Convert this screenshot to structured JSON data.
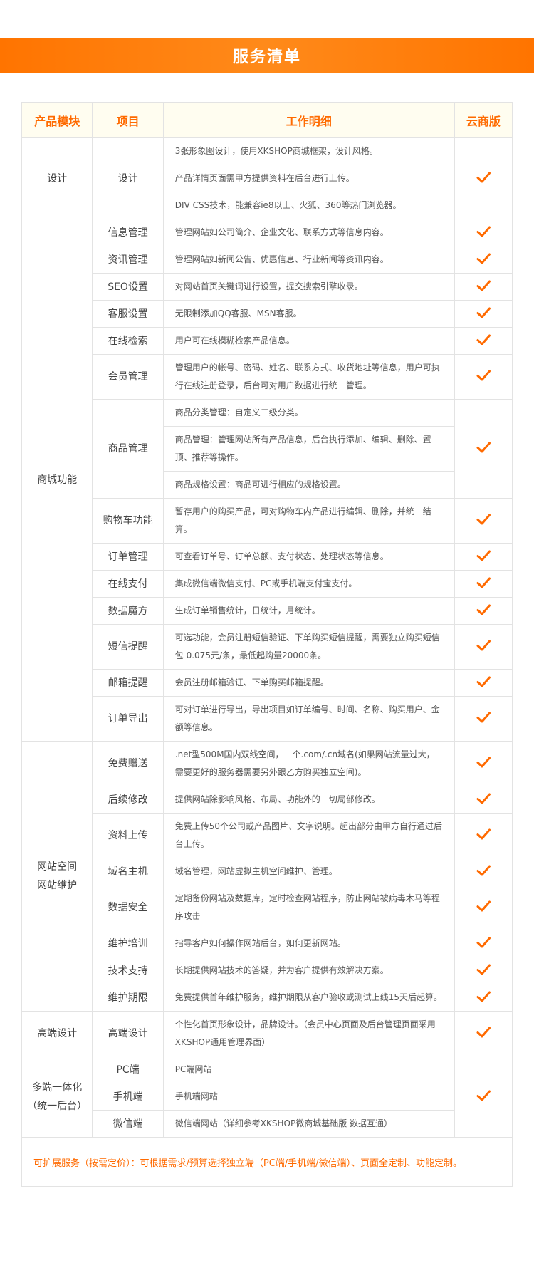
{
  "header": {
    "title": "服务清单"
  },
  "columns": [
    "产品模块",
    "项目",
    "工作明细",
    "云商版"
  ],
  "groups": [
    {
      "module": "设计",
      "rows": [
        {
          "item": "设计",
          "details": [
            "3张形象图设计，使用XKSHOP商城框架，设计风格。",
            "产品详情页面需甲方提供资料在后台进行上传。",
            "DIV CSS技术，能兼容ie8以上、火狐、360等热门浏览器。"
          ]
        }
      ]
    },
    {
      "module": "商城功能",
      "rows": [
        {
          "item": "信息管理",
          "details": [
            "管理网站如公司简介、企业文化、联系方式等信息内容。"
          ]
        },
        {
          "item": "资讯管理",
          "details": [
            "管理网站如新闻公告、优惠信息、行业新闻等资讯内容。"
          ]
        },
        {
          "item": "SEO设置",
          "details": [
            "对网站首页关键词进行设置，提交搜索引擎收录。"
          ]
        },
        {
          "item": "客服设置",
          "details": [
            "无限制添加QQ客服、MSN客服。"
          ]
        },
        {
          "item": "在线检索",
          "details": [
            "用户可在线模糊检索产品信息。"
          ]
        },
        {
          "item": "会员管理",
          "details": [
            "管理用户的帐号、密码、姓名、联系方式、收货地址等信息，用户可执行在线注册登录，后台可对用户数据进行统一管理。"
          ]
        },
        {
          "item": "商品管理",
          "details": [
            "商品分类管理：自定义二级分类。",
            "商品管理：管理网站所有产品信息，后台执行添加、编辑、删除、置顶、推荐等操作。",
            "商品规格设置：商品可进行相应的规格设置。"
          ]
        },
        {
          "item": "购物车功能",
          "details": [
            "暂存用户的购买产品，可对购物车内产品进行编辑、删除，并统一结算。"
          ]
        },
        {
          "item": "订单管理",
          "details": [
            "可查看订单号、订单总额、支付状态、处理状态等信息。"
          ]
        },
        {
          "item": "在线支付",
          "details": [
            "集成微信端微信支付、PC或手机端支付宝支付。"
          ]
        },
        {
          "item": "数据魔方",
          "details": [
            "生成订单销售统计，日统计，月统计。"
          ]
        },
        {
          "item": "短信提醒",
          "details": [
            "可选功能，会员注册短信验证、下单购买短信提醒，需要独立购买短信包 0.075元/条，最低起购量20000条。"
          ]
        },
        {
          "item": "邮箱提醒",
          "details": [
            "会员注册邮箱验证、下单购买邮箱提醒。"
          ]
        },
        {
          "item": "订单导出",
          "details": [
            "可对订单进行导出，导出项目如订单编号、时间、名称、购买用户、金额等信息。"
          ]
        }
      ]
    },
    {
      "module": "网站空间\n网站维护",
      "rows": [
        {
          "item": "免费赠送",
          "details": [
            ".net型500M国内双线空间，一个.com/.cn域名(如果网站流量过大，需要更好的服务器需要另外跟乙方购买独立空间)。"
          ]
        },
        {
          "item": "后续修改",
          "details": [
            "提供网站除影响风格、布局、功能外的一切局部修改。"
          ]
        },
        {
          "item": "资料上传",
          "details": [
            "免费上传50个公司或产品图片、文字说明。超出部分由甲方自行通过后台上传。"
          ]
        },
        {
          "item": "域名主机",
          "details": [
            "域名管理，网站虚拟主机空间维护、管理。"
          ]
        },
        {
          "item": "数据安全",
          "details": [
            "定期备份网站及数据库，定时检查网站程序，防止网站被病毒木马等程序攻击"
          ]
        },
        {
          "item": "维护培训",
          "details": [
            "指导客户如何操作网站后台，如何更新网站。"
          ]
        },
        {
          "item": "技术支持",
          "details": [
            "长期提供网站技术的答疑，并为客户提供有效解决方案。"
          ]
        },
        {
          "item": "维护期限",
          "details": [
            "免费提供首年维护服务，维护期限从客户验收或测试上线15天后起算。"
          ]
        }
      ]
    },
    {
      "module": "高端设计",
      "rows": [
        {
          "item": "高端设计",
          "details": [
            "个性化首页形象设计，品牌设计。（会员中心页面及后台管理页面采用XKSHOP通用管理界面）"
          ]
        }
      ]
    },
    {
      "module": "多端一体化\n（统一后台）",
      "rows": [
        {
          "item": "PC端",
          "details": [
            "PC端网站"
          ]
        },
        {
          "item": "手机端",
          "details": [
            "手机端网站"
          ]
        },
        {
          "item": "微信端",
          "details": [
            "微信端网站（详细参考XKSHOP微商城基础版 数据互通）"
          ]
        }
      ]
    }
  ],
  "footer": {
    "note": "可扩展服务（按需定价）：可根据需求/预算选择独立端（PC端/手机端/微信端）、页面全定制、功能定制。"
  },
  "colors": {
    "accent": "#ff6a00",
    "border": "#e3e3e3",
    "header_bg": "#fffdf0"
  },
  "icons": {
    "check": "check-icon"
  }
}
